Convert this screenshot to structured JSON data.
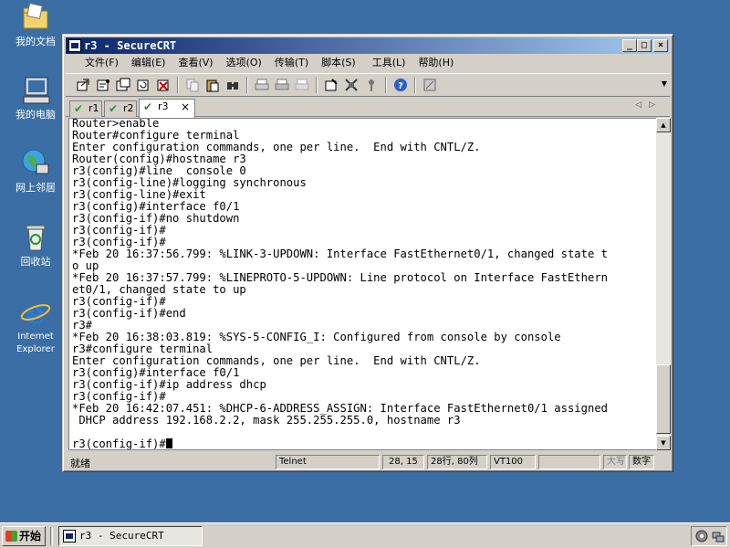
{
  "desktop": {
    "icons": [
      {
        "label": "我的文档",
        "icon": "folder-icon"
      },
      {
        "label": "我的电脑",
        "icon": "computer-icon"
      },
      {
        "label": "网上邻居",
        "icon": "network-icon"
      },
      {
        "label": "回收站",
        "icon": "recycle-bin-icon"
      },
      {
        "label": "Internet Explorer",
        "icon": "ie-icon"
      }
    ]
  },
  "window": {
    "title": "r3 - SecureCRT",
    "caption_buttons": {
      "minimize": "_",
      "maximize": "□",
      "close": "×"
    },
    "menu": [
      "文件(F)",
      "编辑(E)",
      "查看(V)",
      "选项(O)",
      "传输(T)",
      "脚本(S)",
      "工具(L)",
      "帮助(H)"
    ],
    "tabs": [
      {
        "label": "r1",
        "active": false
      },
      {
        "label": "r2",
        "active": false
      },
      {
        "label": "r3",
        "active": true
      }
    ],
    "tab_close": "×",
    "tab_nav": "◁▷",
    "toolbar_glyphs": {
      "check": "✔",
      "chevron": "▼"
    }
  },
  "terminal": {
    "lines": [
      "Router>enable",
      "Router#configure terminal",
      "Enter configuration commands, one per line.  End with CNTL/Z.",
      "Router(config)#hostname r3",
      "r3(config)#line  console 0",
      "r3(config-line)#logging synchronous",
      "r3(config-line)#exit",
      "r3(config)#interface f0/1",
      "r3(config-if)#no shutdown",
      "r3(config-if)#",
      "r3(config-if)#",
      "*Feb 20 16:37:56.799: %LINK-3-UPDOWN: Interface FastEthernet0/1, changed state t",
      "o up",
      "*Feb 20 16:37:57.799: %LINEPROTO-5-UPDOWN: Line protocol on Interface FastEthern",
      "et0/1, changed state to up",
      "r3(config-if)#",
      "r3(config-if)#end",
      "r3#",
      "*Feb 20 16:38:03.819: %SYS-5-CONFIG_I: Configured from console by console",
      "r3#configure terminal",
      "Enter configuration commands, one per line.  End with CNTL/Z.",
      "r3(config)#interface f0/1",
      "r3(config-if)#ip address dhcp",
      "r3(config-if)#",
      "*Feb 20 16:42:07.451: %DHCP-6-ADDRESS_ASSIGN: Interface FastEthernet0/1 assigned",
      " DHCP address 192.168.2.2, mask 255.255.255.0, hostname r3",
      "",
      "r3(config-if)#"
    ],
    "scroll": {
      "up": "▲",
      "down": "▼"
    }
  },
  "statusbar": {
    "ready": "就绪",
    "protocol": "Telnet",
    "cursor_pos": "28, 15",
    "size": "28行, 80列",
    "emulation": "VT100",
    "empty": "",
    "caps": "大写",
    "num": "数字"
  },
  "taskbar": {
    "start": "开始",
    "task_title": "r3 - SecureCRT"
  }
}
